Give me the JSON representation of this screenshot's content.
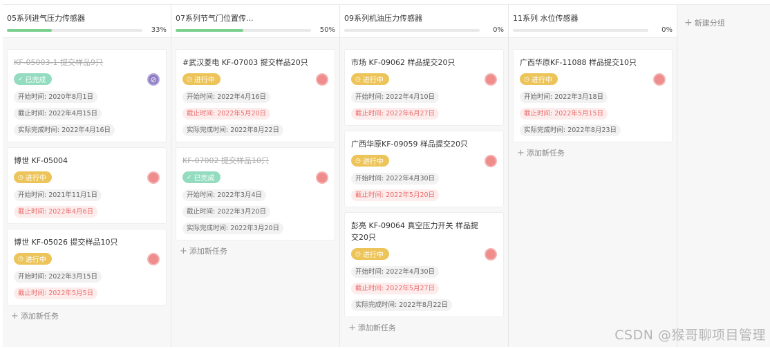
{
  "columns": [
    {
      "title": "05系列进气压力传感器",
      "progress_label": "33%",
      "progress": 0.33,
      "cards": [
        {
          "title": "KF-05003-1 提交样品9只",
          "status": "已完成",
          "status_type": "done",
          "avatar": "blocked",
          "dates": [
            {
              "text": "开始时间: 2020年8月1日",
              "red": false
            },
            {
              "text": "截止时间: 2022年4月15日",
              "red": false
            },
            {
              "text": "实际完成时间: 2022年4月16日",
              "red": false
            }
          ]
        },
        {
          "title": "博世 KF-05004",
          "status": "进行中",
          "status_type": "prog",
          "avatar": "seal",
          "dates": [
            {
              "text": "开始时间: 2021年11月1日",
              "red": false
            },
            {
              "text": "截止时间: 2022年4月6日",
              "red": true
            }
          ]
        },
        {
          "title": "博世 KF-05026 提交样品10只",
          "status": "进行中",
          "status_type": "prog",
          "avatar": "seal",
          "dates": [
            {
              "text": "开始时间: 2022年3月15日",
              "red": false
            },
            {
              "text": "截止时间: 2022年5月5日",
              "red": true
            }
          ]
        }
      ],
      "add_label": "添加新任务"
    },
    {
      "title": "07系列节气门位置传...",
      "progress_label": "50%",
      "progress": 0.5,
      "cards": [
        {
          "title": "#武汉菱电 KF-07003 提交样品20只",
          "status": "进行中",
          "status_type": "prog",
          "avatar": "seal",
          "dates": [
            {
              "text": "开始时间: 2022年4月16日",
              "red": false
            },
            {
              "text": "截止时间: 2022年5月20日",
              "red": true
            },
            {
              "text": "实际完成时间: 2022年8月22日",
              "red": false
            }
          ]
        },
        {
          "title": "KF-07002 提交样品10只",
          "status": "已完成",
          "status_type": "done",
          "avatar": "seal",
          "dates": [
            {
              "text": "开始时间: 2022年3月4日",
              "red": false
            },
            {
              "text": "截止时间: 2022年3月20日",
              "red": false
            },
            {
              "text": "实际完成时间: 2022年3月20日",
              "red": false
            }
          ]
        }
      ],
      "add_label": "添加新任务"
    },
    {
      "title": "09系列机油压力传感器",
      "progress_label": "0%",
      "progress": 0,
      "cards": [
        {
          "title": "市场 KF-09062 样品提交20只",
          "status": "进行中",
          "status_type": "prog",
          "avatar": "seal",
          "dates": [
            {
              "text": "开始时间: 2022年4月10日",
              "red": false
            },
            {
              "text": "截止时间: 2022年6月27日",
              "red": true
            }
          ]
        },
        {
          "title": "广西华原KF-09059 样品提交20只",
          "status": "进行中",
          "status_type": "prog",
          "avatar": "seal",
          "dates": [
            {
              "text": "开始时间: 2022年4月30日",
              "red": false
            },
            {
              "text": "截止时间: 2022年5月20日",
              "red": true
            }
          ]
        },
        {
          "title": "彭亮 KF-09064 真空压力开关 样品提交20只",
          "status": "进行中",
          "status_type": "prog",
          "avatar": "seal",
          "dates": [
            {
              "text": "开始时间: 2022年4月30日",
              "red": false
            },
            {
              "text": "截止时间: 2022年5月27日",
              "red": true
            },
            {
              "text": "实际完成时间: 2022年8月22日",
              "red": false
            }
          ]
        }
      ],
      "add_label": "添加新任务"
    },
    {
      "title": "11系列 水位传感器",
      "progress_label": "0%",
      "progress": 0,
      "cards": [
        {
          "title": "广西华原KF-11088 样品提交10只",
          "status": "进行中",
          "status_type": "prog",
          "avatar": "seal",
          "dates": [
            {
              "text": "开始时间: 2022年3月18日",
              "red": false
            },
            {
              "text": "截止时间: 2022年5月15日",
              "red": true
            },
            {
              "text": "实际完成时间: 2022年8月23日",
              "red": false
            }
          ]
        }
      ],
      "add_label": "添加新任务"
    }
  ],
  "new_group_label": "新建分组",
  "watermark": "CSDN @猴哥聊项目管理",
  "colors": {
    "progress": "#7bd08f",
    "in_progress": "#ecc459",
    "done": "#94dcbf",
    "overdue": "#ea6c6c"
  }
}
